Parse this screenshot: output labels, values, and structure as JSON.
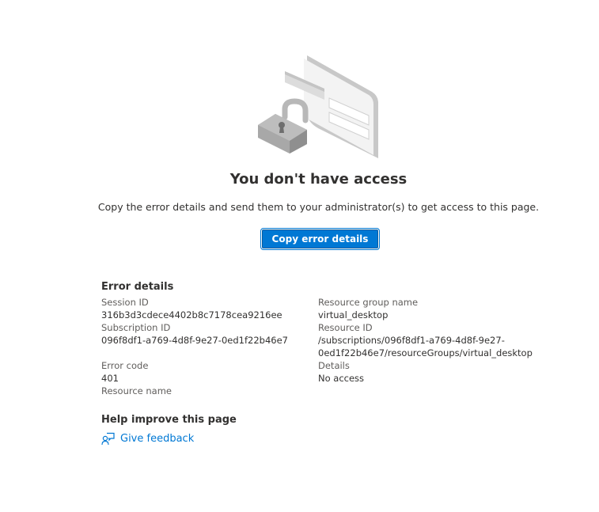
{
  "page": {
    "title": "You don't have access",
    "subtitle": "Copy the error details and send them to your administrator(s) to get access to this page.",
    "copy_button_label": "Copy error details"
  },
  "error_details": {
    "heading": "Error details",
    "session_id_label": "Session ID",
    "session_id_value": "316b3d3cdece4402b8c7178cea9216ee",
    "subscription_id_label": "Subscription ID",
    "subscription_id_value": "096f8df1-a769-4d8f-9e27-0ed1f22b46e7",
    "error_code_label": "Error code",
    "error_code_value": "401",
    "resource_name_label": "Resource name",
    "resource_group_label": "Resource group name",
    "resource_group_value": "virtual_desktop",
    "resource_id_label": "Resource ID",
    "resource_id_value_line1": "/subscriptions/096f8df1-a769-4d8f-9e27-",
    "resource_id_value_line2": "0ed1f22b46e7/resourceGroups/virtual_desktop",
    "details_label": "Details",
    "details_value": "No access"
  },
  "help": {
    "heading": "Help improve this page",
    "feedback_label": "Give feedback"
  },
  "colors": {
    "accent": "#0078d4",
    "text": "#323130",
    "secondary_text": "#605e5c"
  },
  "icons": {
    "illustration": "locked-card-illustration",
    "feedback": "feedback-icon"
  }
}
